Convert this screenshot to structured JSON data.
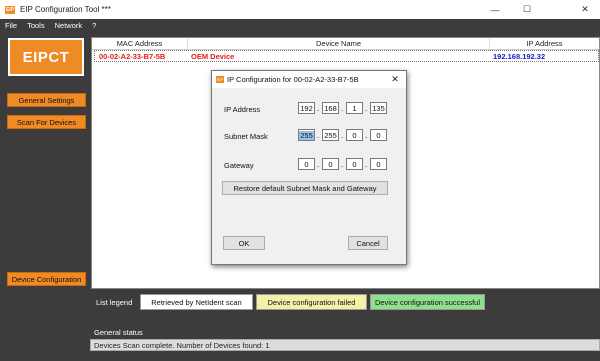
{
  "window": {
    "title": "EIP Configuration Tool ***",
    "icon_text": "EIP",
    "minimize_glyph": "—",
    "maximize_glyph": "☐",
    "close_glyph": "✕"
  },
  "menu": [
    "File",
    "Tools",
    "Network",
    "?"
  ],
  "sidebar": {
    "logo_text": "EIPCT",
    "general_settings_label": "General Settings",
    "scan_label": "Scan For Devices",
    "device_config_label": "Device Configuration"
  },
  "table": {
    "headers": [
      "MAC Address",
      "Device Name",
      "IP Address"
    ],
    "rows": [
      {
        "mac": "00-02-A2-33-B7-5B",
        "name": "OEM Device",
        "ip": "192.168.192.32"
      }
    ]
  },
  "legend": {
    "label": "List legend",
    "items": [
      "Retrieved by NetIdent scan",
      "Device configuration failed",
      "Device configuration successful"
    ]
  },
  "status": {
    "label": "General status",
    "text": "Devices Scan complete. Number of Devices found: 1"
  },
  "dialog": {
    "title": "IP Configuration for 00-02-A2-33-B7-5B",
    "icon_text": "EIP",
    "close_glyph": "✕",
    "ip_label": "IP Address",
    "ip": [
      "192",
      "168",
      "1",
      "135"
    ],
    "mask_label": "Subnet Mask",
    "mask": [
      "255",
      "255",
      "0",
      "0"
    ],
    "gateway_label": "Gateway",
    "gateway": [
      "0",
      "0",
      "0",
      "0"
    ],
    "dot": ".",
    "restore_label": "Restore default Subnet Mask and Gateway",
    "ok_label": "OK",
    "cancel_label": "Cancel"
  },
  "colors": {
    "accent": "#f08a24",
    "mac_text": "#e0201a",
    "name_text": "#e0201a",
    "ip_text": "#1a1acc",
    "legend_white": "#ffffff",
    "legend_failed": "#f5f0a8",
    "legend_success": "#8fe08c"
  }
}
